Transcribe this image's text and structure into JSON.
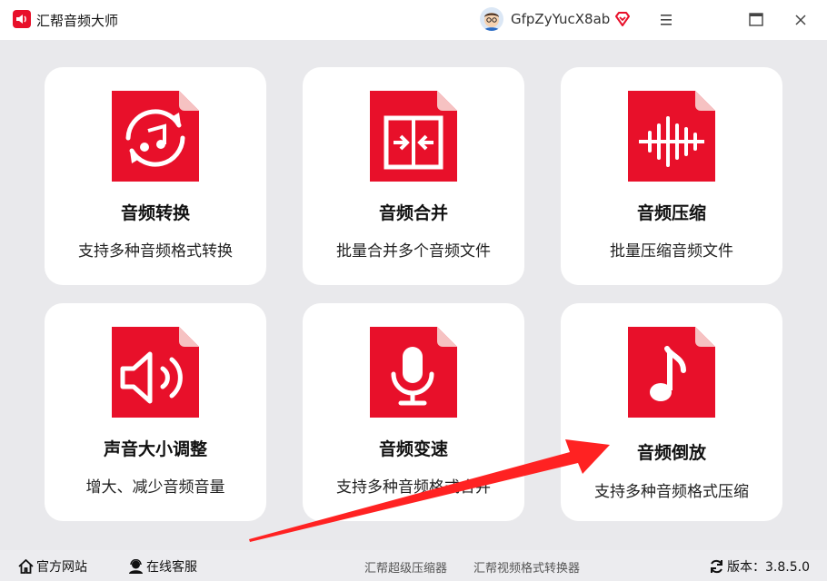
{
  "app": {
    "title": "汇帮音频大师",
    "brand_color": "#e8102a"
  },
  "user": {
    "name": "GfpZyYucX8ab"
  },
  "tools": [
    {
      "title": "音频转换",
      "desc": "支持多种音频格式转换",
      "icon": "audio-convert-icon"
    },
    {
      "title": "音频合并",
      "desc": "批量合并多个音频文件",
      "icon": "audio-merge-icon"
    },
    {
      "title": "音频压缩",
      "desc": "批量压缩音频文件",
      "icon": "audio-compress-icon"
    },
    {
      "title": "声音大小调整",
      "desc": "增大、减少音频音量",
      "icon": "volume-icon"
    },
    {
      "title": "音频变速",
      "desc": "支持多种音频格式合并",
      "icon": "microphone-icon"
    },
    {
      "title": "音频倒放",
      "desc": "支持多种音频格式压缩",
      "icon": "music-note-icon"
    }
  ],
  "footer": {
    "website": "官方网站",
    "service": "在线客服",
    "link1": "汇帮超级压缩器",
    "link2": "汇帮视频格式转换器",
    "version_label": "版本：",
    "version": "3.8.5.0"
  }
}
